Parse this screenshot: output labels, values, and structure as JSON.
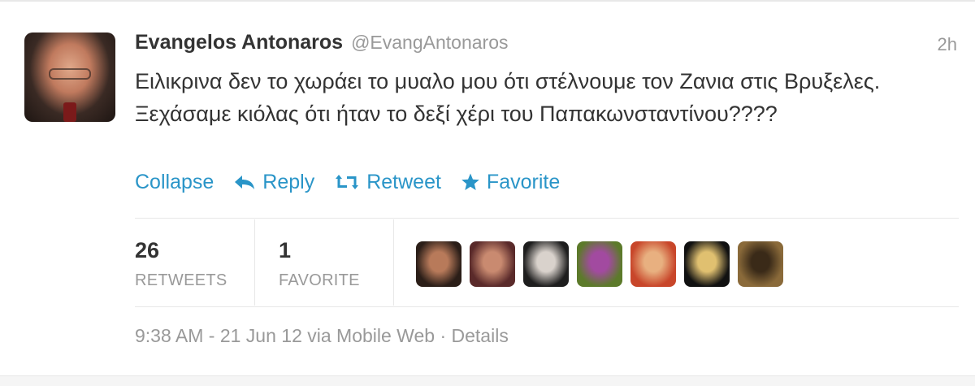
{
  "tweet": {
    "author_name": "Evangelos Antonaros",
    "author_handle": "@EvangAntonaros",
    "time_ago": "2h",
    "text": "Ειλικρινα δεν το χωράει το μυαλο μου ότι στέλνουμε τον Ζανια στις Βρυξελες. Ξεχάσαμε κιόλας ότι ήταν το δεξί χέρι του Παπακωνσταντίνου????"
  },
  "actions": {
    "collapse": "Collapse",
    "reply": "Reply",
    "retweet": "Retweet",
    "favorite": "Favorite",
    "reply_icon": "reply-arrow-icon",
    "retweet_icon": "retweet-arrows-icon",
    "favorite_icon": "star-icon"
  },
  "stats": {
    "retweets_count": "26",
    "retweets_label": "RETWEETS",
    "favorites_count": "1",
    "favorites_label": "FAVORITE"
  },
  "favoriters": [
    {
      "name": "favoriter-avatar-1",
      "colors": [
        "#2b1e18",
        "#b87a5a"
      ]
    },
    {
      "name": "favoriter-avatar-2",
      "colors": [
        "#5a2a2a",
        "#c98a70"
      ]
    },
    {
      "name": "favoriter-avatar-3",
      "colors": [
        "#1e1e1e",
        "#d9d2cc"
      ]
    },
    {
      "name": "favoriter-avatar-4",
      "colors": [
        "#5c7a2a",
        "#a24aa0"
      ]
    },
    {
      "name": "favoriter-avatar-5",
      "colors": [
        "#c8462a",
        "#e8b080"
      ]
    },
    {
      "name": "favoriter-avatar-6",
      "colors": [
        "#111111",
        "#e0c070"
      ]
    },
    {
      "name": "favoriter-avatar-7",
      "colors": [
        "#8a6a3a",
        "#3a2a18"
      ]
    }
  ],
  "meta": {
    "timestamp": "9:38 AM - 21 Jun 12 via Mobile Web",
    "separator": "·",
    "details": "Details"
  },
  "colors": {
    "link": "#2a95c8",
    "text": "#333333",
    "muted": "#999999"
  }
}
